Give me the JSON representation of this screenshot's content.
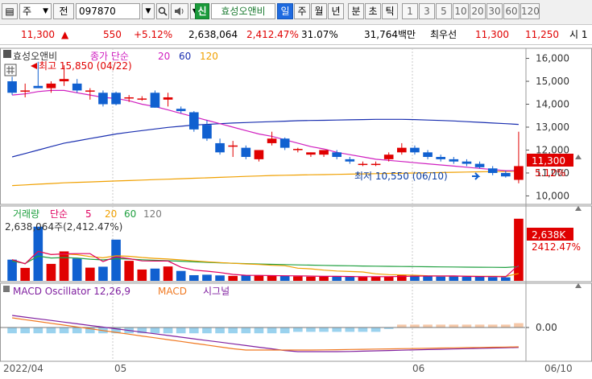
{
  "toolbar": {
    "menu_btn": "▤",
    "period_sel": "주",
    "prev_label": "전",
    "code_value": "097870",
    "signal_btn": "신",
    "stock_name": "효성오앤비",
    "periods": [
      "일",
      "주",
      "월",
      "년",
      "분",
      "초",
      "틱"
    ],
    "minutes": [
      "1",
      "3",
      "5",
      "10",
      "20",
      "30",
      "60",
      "120"
    ]
  },
  "quote": {
    "price": "11,300",
    "arrow": "▲",
    "change": "550",
    "change_pct": "+5.12%",
    "volume": "2,638,064",
    "vol_ratio": "2,412.47%",
    "turnover": "31.07%",
    "amount": "31,764백만",
    "ask_label": "최우선",
    "ask": "11,300",
    "bid": "11,250",
    "open_label": "시 1"
  },
  "price_panel": {
    "name": "효성오앤비",
    "ma_label": "종가 단순",
    "ma_periods": [
      "20",
      "60",
      "120"
    ],
    "high_note": "최고 15,850 (04/22)",
    "low_note": "최저 10,550 (06/10)",
    "y_ticks": [
      "16,000",
      "15,000",
      "14,000",
      "13,000",
      "12,000",
      "11,000",
      "10,000"
    ],
    "current_tag": "11,300",
    "current_pct": "5.12%"
  },
  "volume_panel": {
    "title": "거래량",
    "ma_label": "단순",
    "ma_periods": [
      "5",
      "20",
      "60",
      "120"
    ],
    "info": "2,638,064주(2,412.47%)",
    "tag": "2,638K",
    "tag_pct": "2412.47%"
  },
  "macd_panel": {
    "title": "MACD Oscillator 12,26,9",
    "macd_label": "MACD",
    "signal_label": "시그널",
    "zero_tick": "0.00"
  },
  "x_axis": [
    "2022/04",
    "05",
    "06",
    "06/10"
  ],
  "colors": {
    "up": "#e00000",
    "down": "#1060d0",
    "ma20": "#d020c0",
    "ma60": "#1a2fb0",
    "ma120": "#f0a000",
    "vol_ma5": "#e00060",
    "vol_ma20": "#f0a000",
    "vol_ma60": "#20a040",
    "macd": "#f07820",
    "signal": "#8020a0",
    "osc": "#9ad2ee"
  },
  "chart_data": {
    "type": "candlestick",
    "ohlc": [
      [
        15000,
        15200,
        14400,
        14500
      ],
      [
        14600,
        14900,
        14300,
        14600
      ],
      [
        14800,
        15850,
        14700,
        14700
      ],
      [
        14700,
        15000,
        14500,
        14900
      ],
      [
        15000,
        15700,
        14800,
        15100
      ],
      [
        14900,
        15100,
        14500,
        14600
      ],
      [
        14600,
        14700,
        14200,
        14600
      ],
      [
        14500,
        14600,
        13900,
        14000
      ],
      [
        14500,
        14550,
        13950,
        14000
      ],
      [
        14300,
        14400,
        14100,
        14300
      ],
      [
        14250,
        14350,
        14150,
        14250
      ],
      [
        14500,
        14600,
        13850,
        13850
      ],
      [
        14200,
        14500,
        13900,
        14300
      ],
      [
        13800,
        13900,
        13600,
        13700
      ],
      [
        13650,
        13700,
        12800,
        12900
      ],
      [
        13100,
        13300,
        12400,
        12500
      ],
      [
        12300,
        12500,
        11800,
        11900
      ],
      [
        12200,
        12400,
        11700,
        12200
      ],
      [
        12100,
        12200,
        11600,
        11700
      ],
      [
        11600,
        12000,
        11500,
        12000
      ],
      [
        12300,
        12800,
        12200,
        12500
      ],
      [
        12500,
        12550,
        12000,
        12100
      ],
      [
        12000,
        12100,
        11900,
        12050
      ],
      [
        11800,
        11900,
        11700,
        11900
      ],
      [
        11800,
        12000,
        11700,
        12000
      ],
      [
        11900,
        12000,
        11600,
        11700
      ],
      [
        11600,
        11700,
        11400,
        11500
      ],
      [
        11400,
        11500,
        11300,
        11400
      ],
      [
        11400,
        11500,
        11300,
        11400
      ],
      [
        11600,
        11900,
        11500,
        11800
      ],
      [
        11900,
        12300,
        11800,
        12100
      ],
      [
        12100,
        12200,
        11800,
        11900
      ],
      [
        11900,
        12000,
        11600,
        11700
      ],
      [
        11700,
        11800,
        11500,
        11600
      ],
      [
        11600,
        11700,
        11400,
        11500
      ],
      [
        11500,
        11600,
        11300,
        11400
      ],
      [
        11400,
        11500,
        11200,
        11250
      ],
      [
        11200,
        11300,
        10900,
        11000
      ],
      [
        11000,
        11100,
        10800,
        10850
      ],
      [
        10700,
        12800,
        10550,
        11300
      ]
    ],
    "volume": [
      900,
      550,
      2300,
      720,
      1250,
      950,
      560,
      600,
      1750,
      850,
      480,
      520,
      610,
      420,
      240,
      260,
      230,
      210,
      240,
      220,
      205,
      210,
      190,
      175,
      180,
      200,
      170,
      165,
      170,
      180,
      260,
      220,
      190,
      180,
      200,
      170,
      190,
      160,
      150,
      2638
    ],
    "ma20": [
      14400,
      14450,
      14550,
      14600,
      14600,
      14500,
      14400,
      14300,
      14250,
      14150,
      14000,
      13900,
      13750,
      13600,
      13450,
      13300,
      13150,
      13000,
      12850,
      12700,
      12600,
      12450,
      12300,
      12150,
      12050,
      11900,
      11800,
      11700,
      11600,
      11550,
      11500,
      11450,
      11400,
      11350,
      11300,
      11250,
      11200,
      11150,
      11100,
      11100
    ],
    "ma60": [
      11700,
      11850,
      12000,
      12150,
      12300,
      12400,
      12500,
      12600,
      12700,
      12780,
      12850,
      12920,
      12990,
      13040,
      13090,
      13120,
      13150,
      13180,
      13200,
      13220,
      13240,
      13260,
      13280,
      13290,
      13300,
      13310,
      13320,
      13330,
      13340,
      13340,
      13340,
      13330,
      13310,
      13290,
      13270,
      13240,
      13210,
      13180,
      13150,
      13120
    ],
    "ma120": [
      10450,
      10480,
      10510,
      10540,
      10570,
      10590,
      10610,
      10630,
      10650,
      10670,
      10690,
      10710,
      10730,
      10750,
      10770,
      10790,
      10810,
      10830,
      10850,
      10870,
      10890,
      10900,
      10910,
      10920,
      10930,
      10940,
      10950,
      10960,
      10970,
      10980,
      10990,
      11000,
      11010,
      11020,
      11030,
      11040,
      11050,
      11060,
      11070,
      11080
    ],
    "price_ylim": [
      9700,
      16300
    ]
  }
}
